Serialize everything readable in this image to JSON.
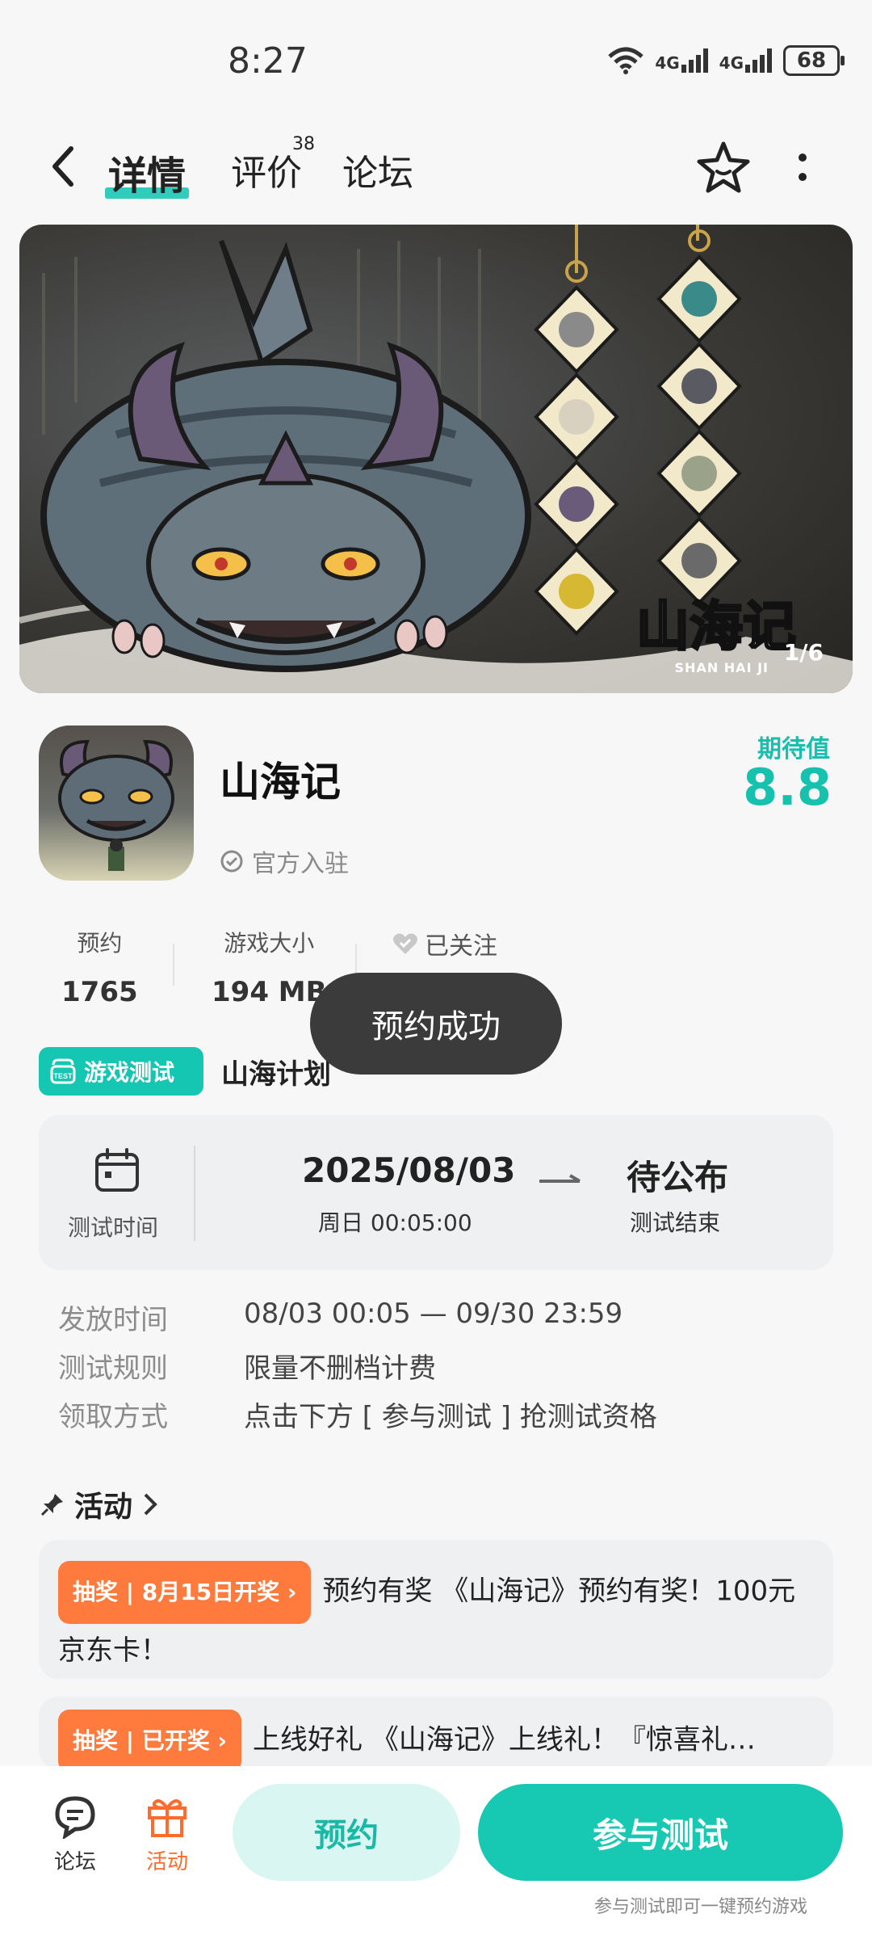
{
  "status_bar": {
    "time": "8:27",
    "signal1": "4G",
    "signal2": "4G",
    "battery": "68"
  },
  "nav": {
    "tabs": [
      {
        "label": "详情",
        "active": true
      },
      {
        "label": "评价",
        "badge": "38"
      },
      {
        "label": "论坛"
      }
    ],
    "icons": [
      "back-arrow",
      "star-favorite",
      "more-vertical"
    ]
  },
  "banner": {
    "counter": "1/6",
    "logo_text": "山海记",
    "logo_sub": "SHAN HAI JI"
  },
  "game": {
    "title": "山海记",
    "official_label": "官方入驻",
    "expectation_label": "期待值",
    "expectation_value": "8.8"
  },
  "stats": {
    "reserve_label": "预约",
    "reserve_value": "1765",
    "size_label": "游戏大小",
    "size_value": "194 MB",
    "follow_label": "已关注"
  },
  "toast": "预约成功",
  "test": {
    "badge": "游戏测试",
    "badge_icon_text": "TEST",
    "plan_name": "山海计划",
    "time_label": "测试时间",
    "start_date": "2025/08/03",
    "start_sub": "周日  00:05:00",
    "end_main": "待公布",
    "end_sub": "测试结束"
  },
  "details": [
    {
      "key": "发放时间",
      "value": "08/03 00:05 — 09/30 23:59"
    },
    {
      "key": "测试规则",
      "value": "限量不删档计费"
    },
    {
      "key": "领取方式",
      "value": "点击下方 [ 参与测试 ] 抢测试资格"
    }
  ],
  "activity": {
    "heading": "活动",
    "items": [
      {
        "tag": "抽奖 | 8月15日开奖 ›",
        "text": "预约有奖 《山海记》预约有奖！100元京东卡！"
      },
      {
        "tag": "抽奖 | 已开奖 ›",
        "text": "上线好礼 《山海记》上线礼！『惊喜礼…"
      }
    ]
  },
  "bottom": {
    "forum": "论坛",
    "activity": "活动",
    "reserve_button": "预约",
    "join_button": "参与测试",
    "join_hint": "参与测试即可一键预约游戏"
  },
  "colors": {
    "accent": "#17c8b3",
    "orange": "#ff7a3d"
  }
}
